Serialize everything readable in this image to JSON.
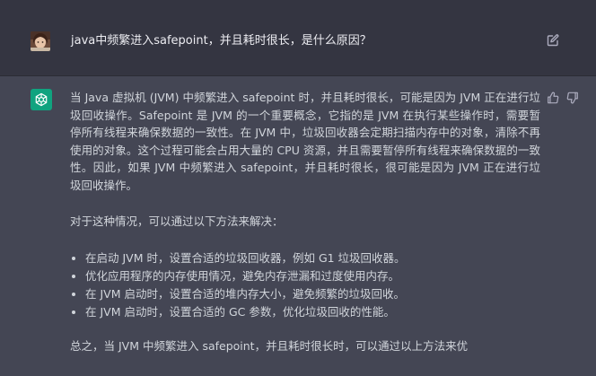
{
  "user": {
    "message": "java中频繁进入safepoint，并且耗时很长，是什么原因？"
  },
  "assistant": {
    "paragraph1": "当 Java 虚拟机 (JVM) 中频繁进入 safepoint 时，并且耗时很长，可能是因为 JVM 正在进行垃圾回收操作。Safepoint 是 JVM 的一个重要概念，它指的是 JVM 在执行某些操作时，需要暂停所有线程来确保数据的一致性。在 JVM 中，垃圾回收器会定期扫描内存中的对象，清除不再使用的对象。这个过程可能会占用大量的 CPU 资源，并且需要暂停所有线程来确保数据的一致性。因此，如果 JVM 中频繁进入 safepoint，并且耗时很长，很可能是因为 JVM 正在进行垃圾回收操作。",
    "paragraph2": "对于这种情况，可以通过以下方法来解决：",
    "bullets": [
      "在启动 JVM 时，设置合适的垃圾回收器，例如 G1 垃圾回收器。",
      "优化应用程序的内存使用情况，避免内存泄漏和过度使用内存。",
      "在 JVM 启动时，设置合适的堆内存大小，避免频繁的垃圾回收。",
      "在 JVM 启动时，设置合适的 GC 参数，优化垃圾回收的性能。"
    ],
    "paragraph3": "总之，当 JVM 中频繁进入 safepoint，并且耗时很长时，可以通过以上方法来优"
  },
  "icons": {
    "user_avatar": "user-avatar-photo",
    "edit": "edit-icon",
    "assistant_avatar": "chatgpt-logo-icon",
    "thumb_up": "thumbs-up-icon",
    "thumb_down": "thumbs-down-icon"
  },
  "colors": {
    "user_row_bg": "#343541",
    "assistant_row_bg": "#444654",
    "assistant_avatar_bg": "#10a37f",
    "text": "#d1d5db"
  }
}
